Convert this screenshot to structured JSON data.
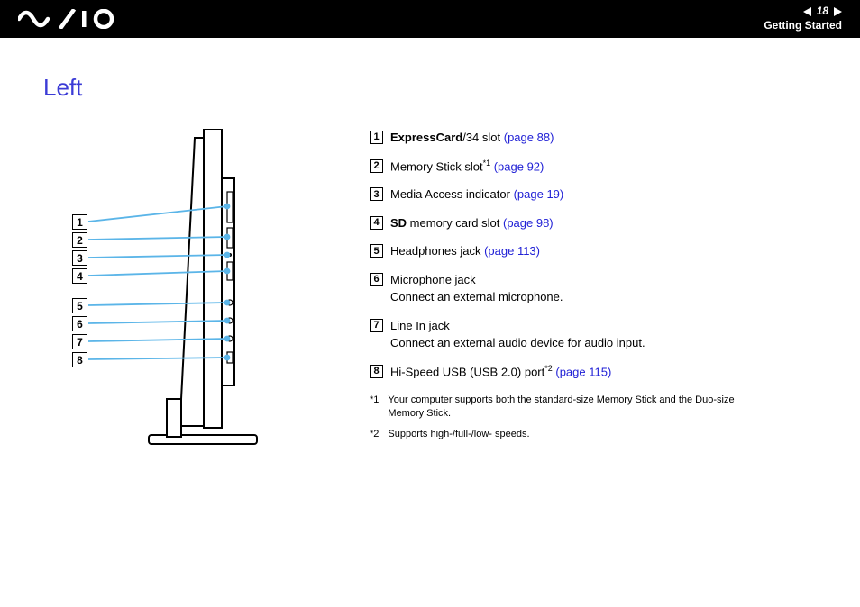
{
  "header": {
    "pageNumber": "18",
    "breadcrumb": "Getting Started"
  },
  "title": "Left",
  "items": [
    {
      "num": "1",
      "prefixBold": "ExpressCard",
      "text": "/34 slot ",
      "link": "(page 88)"
    },
    {
      "num": "2",
      "text": "Memory Stick slot",
      "sup": "*1",
      "link": "(page 92)"
    },
    {
      "num": "3",
      "text": "Media Access indicator ",
      "link": "(page 19)"
    },
    {
      "num": "4",
      "prefixBold": "SD",
      "text": " memory card slot ",
      "link": "(page 98)"
    },
    {
      "num": "5",
      "text": "Headphones jack ",
      "link": "(page 113)"
    },
    {
      "num": "6",
      "text": "Microphone jack",
      "text2": "Connect an external microphone."
    },
    {
      "num": "7",
      "text": "Line In jack",
      "text2": "Connect an external audio device for audio input."
    },
    {
      "num": "8",
      "text": "Hi-Speed USB (USB 2.0) port",
      "sup": "*2",
      "link": "(page 115)"
    }
  ],
  "footnotes": [
    {
      "mark": "*1",
      "text": "Your computer supports both the standard-size Memory Stick and the Duo-size Memory Stick."
    },
    {
      "mark": "*2",
      "text": "Supports high-/full-/low- speeds."
    }
  ],
  "diagramLabels": [
    "1",
    "2",
    "3",
    "4",
    "5",
    "6",
    "7",
    "8"
  ]
}
